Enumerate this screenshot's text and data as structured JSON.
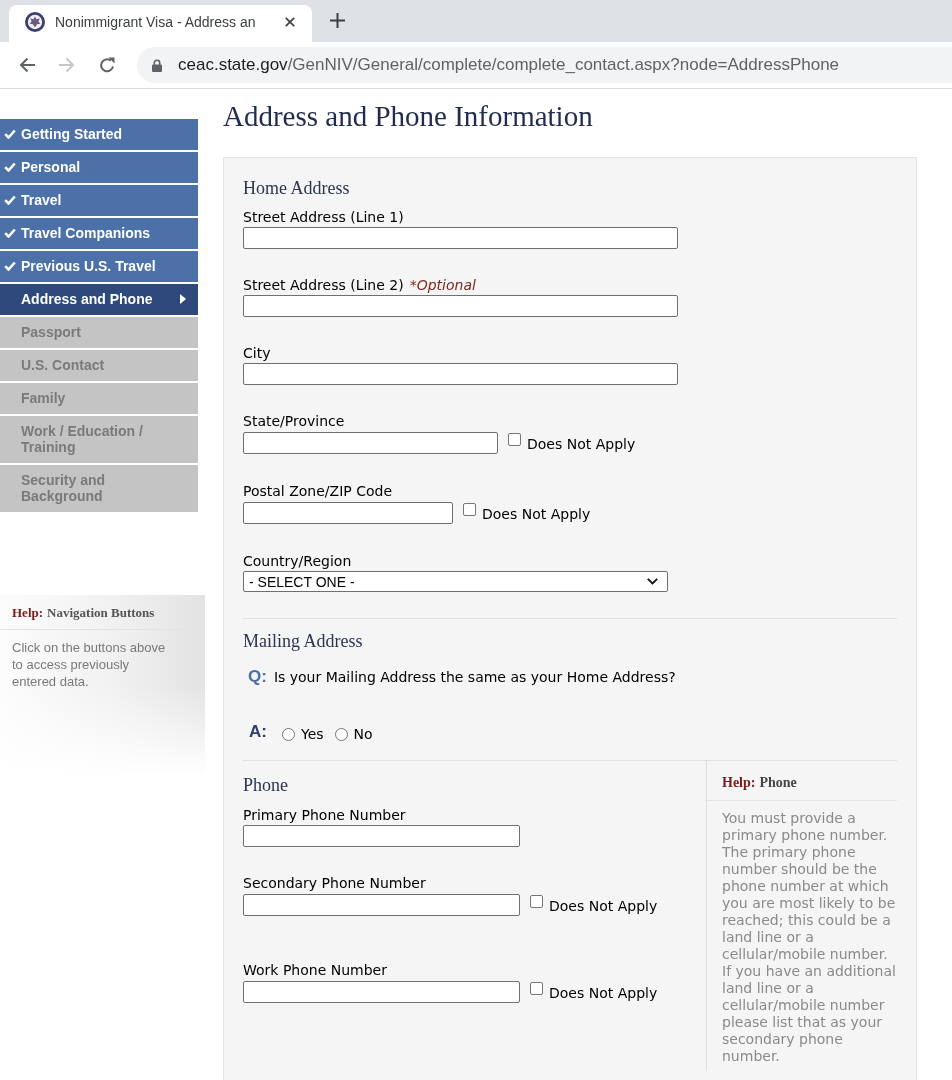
{
  "browser": {
    "tab": {
      "title": "Nonimmigrant Visa - Address an"
    },
    "nav_buttons": [
      {
        "kind": "back",
        "disabled": false
      },
      {
        "kind": "forward",
        "disabled": true
      },
      {
        "kind": "reload",
        "disabled": false
      }
    ],
    "url": {
      "host": "ceac.state.gov",
      "path": "/GenNIV/General/complete/complete_contact.aspx?node=AddressPhone"
    }
  },
  "sidebar": {
    "items": [
      {
        "label": "Getting Started",
        "completed": true,
        "selected": false
      },
      {
        "label": "Personal",
        "completed": true,
        "selected": false
      },
      {
        "label": "Travel",
        "completed": true,
        "selected": false
      },
      {
        "label": "Travel Companions",
        "completed": true,
        "selected": false
      },
      {
        "label": "Previous U.S. Travel",
        "completed": true,
        "selected": false
      },
      {
        "label": "Address and Phone",
        "completed": false,
        "selected": true
      },
      {
        "label": "Passport",
        "completed": false,
        "selected": false
      },
      {
        "label": "U.S. Contact",
        "completed": false,
        "selected": false
      },
      {
        "label": "Family",
        "completed": false,
        "selected": false
      },
      {
        "label": "Work / Education / Training",
        "completed": false,
        "selected": false
      },
      {
        "label": "Security and Background",
        "completed": false,
        "selected": false
      }
    ],
    "help": {
      "label": "Help:",
      "title": "Navigation Buttons",
      "text": "Click on the buttons above to access previously entered data."
    }
  },
  "page_title": "Address and Phone Information",
  "home_address": {
    "heading": "Home Address",
    "fields": [
      {
        "kind": "text",
        "label": "Street Address (Line 1)"
      },
      {
        "kind": "text",
        "label": "Street Address (Line 2)",
        "note": "*Optional"
      },
      {
        "kind": "text",
        "label": "City"
      },
      {
        "kind": "text",
        "label": "State/Province",
        "does_not_apply": {
          "label": "Does Not Apply",
          "checked": false
        }
      },
      {
        "kind": "text",
        "label": "Postal Zone/ZIP Code",
        "does_not_apply": {
          "label": "Does Not Apply",
          "checked": false
        }
      },
      {
        "kind": "select",
        "label": "Country/Region",
        "value": "- SELECT ONE -"
      }
    ]
  },
  "mailing_address": {
    "heading": "Mailing Address",
    "question": {
      "marker": "Q:",
      "text": "Is your Mailing Address the same as your Home Address?"
    },
    "answer": {
      "marker": "A:",
      "options": [
        {
          "label": "Yes",
          "selected": false
        },
        {
          "label": "No",
          "selected": false
        }
      ]
    }
  },
  "phone": {
    "heading": "Phone",
    "fields": [
      {
        "kind": "text",
        "label": "Primary Phone Number"
      },
      {
        "kind": "text",
        "label": "Secondary Phone Number",
        "does_not_apply": {
          "label": "Does Not Apply",
          "checked": false
        }
      },
      {
        "kind": "text",
        "label": "Work Phone Number",
        "does_not_apply": {
          "label": "Does Not Apply",
          "checked": false
        }
      }
    ],
    "help": {
      "label": "Help:",
      "title": "Phone",
      "text": "You must provide a primary phone number. The primary phone number should be the phone number at which you are most likely to be reached; this could be a land line or a cellular/mobile number. If you have an additional land line or a cellular/mobile number please list that as your secondary phone number."
    }
  }
}
